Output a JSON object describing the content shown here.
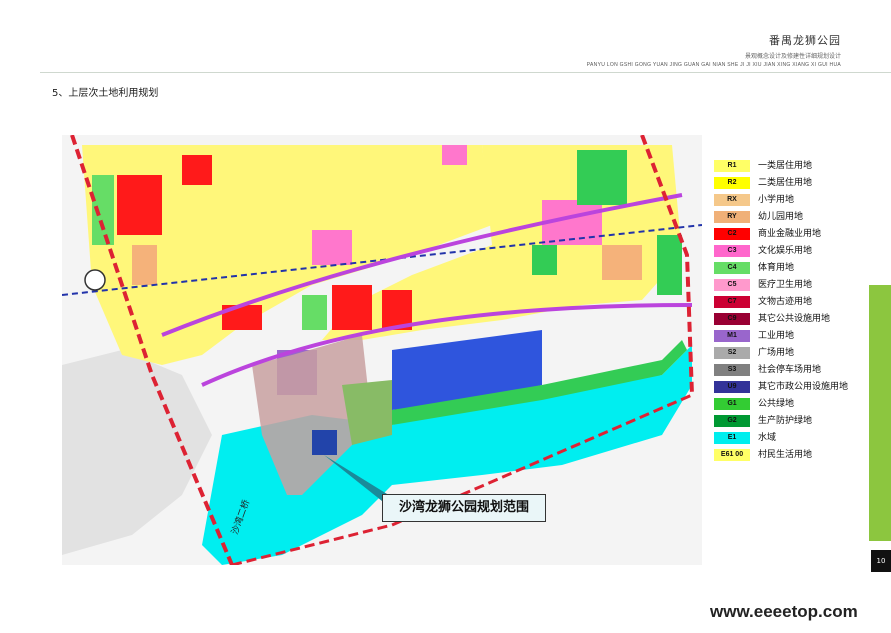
{
  "header": {
    "title": "番禺龙狮公园",
    "subtitle": "景观概念设计及修建性详细规划设计",
    "subtitle_en": "PANYU LON GSHI GONG YUAN JING GUAN GAI NIAN SHE JI JI XIU JIAN XING XIANG XI GUI HUA"
  },
  "section_title": "5、上层次土地利用规划",
  "map": {
    "callout": "沙湾龙狮公园规划范围",
    "road_label": "沙湾二桥"
  },
  "legend": [
    {
      "code": "R1",
      "label": "一类居住用地",
      "color": "#ffff66"
    },
    {
      "code": "R2",
      "label": "二类居住用地",
      "color": "#ffff00"
    },
    {
      "code": "RX",
      "label": "小学用地",
      "color": "#f5c88a"
    },
    {
      "code": "RY",
      "label": "幼儿园用地",
      "color": "#f0b078"
    },
    {
      "code": "C2",
      "label": "商业金融业用地",
      "color": "#ff0000"
    },
    {
      "code": "C3",
      "label": "文化娱乐用地",
      "color": "#ff66cc"
    },
    {
      "code": "C4",
      "label": "体育用地",
      "color": "#66dd66"
    },
    {
      "code": "C5",
      "label": "医疗卫生用地",
      "color": "#ff99cc"
    },
    {
      "code": "C7",
      "label": "文物古迹用地",
      "color": "#cc0033"
    },
    {
      "code": "C9",
      "label": "其它公共设施用地",
      "color": "#990033"
    },
    {
      "code": "M1",
      "label": "工业用地",
      "color": "#9966cc"
    },
    {
      "code": "S2",
      "label": "广场用地",
      "color": "#aaaaaa"
    },
    {
      "code": "S3",
      "label": "社会停车场用地",
      "color": "#808080"
    },
    {
      "code": "U9",
      "label": "其它市政公用设施用地",
      "color": "#333399"
    },
    {
      "code": "G1",
      "label": "公共绿地",
      "color": "#33cc33"
    },
    {
      "code": "G2",
      "label": "生产防护绿地",
      "color": "#009933"
    },
    {
      "code": "E1",
      "label": "水域",
      "color": "#00eeee"
    },
    {
      "code": "E61 00",
      "label": "村民生活用地",
      "color": "#ffff66"
    }
  ],
  "page_number": "10",
  "watermark": "www.eeeetop.com"
}
